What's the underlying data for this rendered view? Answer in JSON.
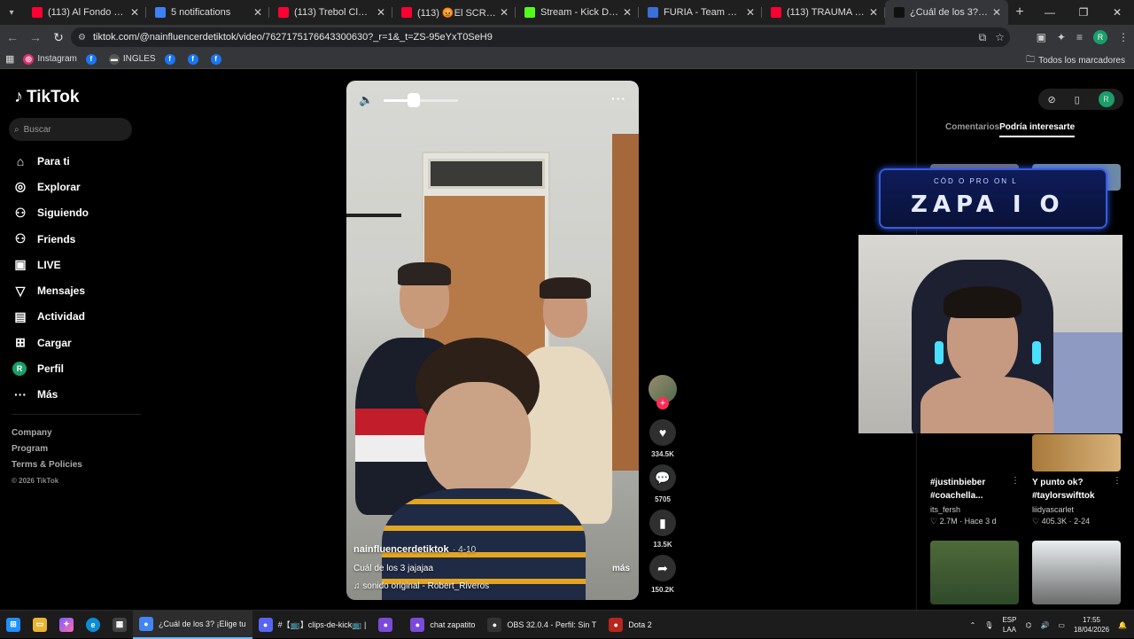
{
  "browser": {
    "tabs": [
      {
        "title": "(113) Al Fondo hay Sitio 8",
        "color": "#ff0033"
      },
      {
        "title": "5 notifications",
        "color": "#3b82f6"
      },
      {
        "title": "(113) Trebol Clan - Bailam",
        "color": "#ff0033"
      },
      {
        "title": "(113) 😡El SCRIM más ES",
        "color": "#ff0033"
      },
      {
        "title": "Stream - Kick Dashboard",
        "color": "#53fc18"
      },
      {
        "title": "FURIA - Team Vitality 18/",
        "color": "#3b6fd8"
      },
      {
        "title": "(113) TRAUMA MARGINAL",
        "color": "#ff0033"
      },
      {
        "title": "¿Cuál de los 3? ¡Elige",
        "color": "#111111"
      }
    ],
    "url": "tiktok.com/@nainfluencerdetiktok/video/7627175176643300630?_r=1&_t=ZS-95eYxT0SeH9",
    "bookmarks": [
      {
        "label": "Instagram",
        "color": "#e1306c",
        "icon": "instagram-icon"
      },
      {
        "label": "",
        "color": "#1877f2",
        "icon": "facebook-icon"
      },
      {
        "label": "INGLES",
        "color": "#555555",
        "icon": "flag-icon"
      },
      {
        "label": "",
        "color": "#1877f2",
        "icon": "facebook-icon"
      },
      {
        "label": "",
        "color": "#1877f2",
        "icon": "facebook-icon"
      },
      {
        "label": "",
        "color": "#1877f2",
        "icon": "facebook-icon"
      }
    ],
    "all_bookmarks": "Todos los marcadores",
    "profile_initial": "R"
  },
  "tiktok": {
    "logo": "TikTok",
    "search_placeholder": "Buscar",
    "nav": [
      {
        "label": "Para ti",
        "icon": "home-icon"
      },
      {
        "label": "Explorar",
        "icon": "compass-icon"
      },
      {
        "label": "Siguiendo",
        "icon": "following-icon"
      },
      {
        "label": "Friends",
        "icon": "friends-icon"
      },
      {
        "label": "LIVE",
        "icon": "live-icon"
      },
      {
        "label": "Mensajes",
        "icon": "messages-icon"
      },
      {
        "label": "Actividad",
        "icon": "activity-icon"
      },
      {
        "label": "Cargar",
        "icon": "upload-icon"
      },
      {
        "label": "Perfil",
        "icon": "profile-avatar"
      },
      {
        "label": "Más",
        "icon": "more-icon"
      }
    ],
    "footer": [
      "Company",
      "Program",
      "Terms & Policies"
    ],
    "copyright": "© 2026 TikTok",
    "video": {
      "author": "nainfluencerdetiktok",
      "date": "· 4-10",
      "caption": "Cuál de los 3 jajajaa",
      "more": "más",
      "sound": "♫  sonido original - Robert_Riveros",
      "volume": 0.4
    },
    "actions": {
      "likes": "334.5K",
      "comments": "5705",
      "saves": "13.5K",
      "shares": "150.2K"
    },
    "right_panel": {
      "tabs": [
        "Comentarios",
        "Podría interesarte"
      ],
      "cards": [
        {
          "title": "#justinbieber #coachella...",
          "user": "its_fersh",
          "meta": "♡ 2.7M · Hace 3 d"
        },
        {
          "title": "Y punto ok? #taylorswifttok",
          "user": "liidyascarlet",
          "meta": "♡ 405.3K · 2-24"
        }
      ]
    },
    "overlay_text": {
      "small": "CÓD  O PRO     ON  L",
      "big": "ZAPA  I  O"
    }
  },
  "taskbar": {
    "items": [
      {
        "label": "¿Cuál de los 3? ¡Elige tu",
        "color": "#4285f4",
        "icon": "chrome-icon"
      },
      {
        "label": "#【📺】clips-de-kick📺 |",
        "color": "#5865f2",
        "icon": "discord-icon"
      },
      {
        "label": "",
        "color": "#7a4bd8",
        "icon": "twitch-icon"
      },
      {
        "label": "chat zapatito",
        "color": "#7a4bd8",
        "icon": "twitch-icon"
      },
      {
        "label": "OBS 32.0.4 - Perfil: Sin T",
        "color": "#333333",
        "icon": "obs-icon"
      },
      {
        "label": "Dota 2",
        "color": "#b8261e",
        "icon": "dota-icon"
      }
    ],
    "lang": "ESP",
    "lang2": "LAA",
    "time": "17:55",
    "date": "18/04/2026"
  }
}
